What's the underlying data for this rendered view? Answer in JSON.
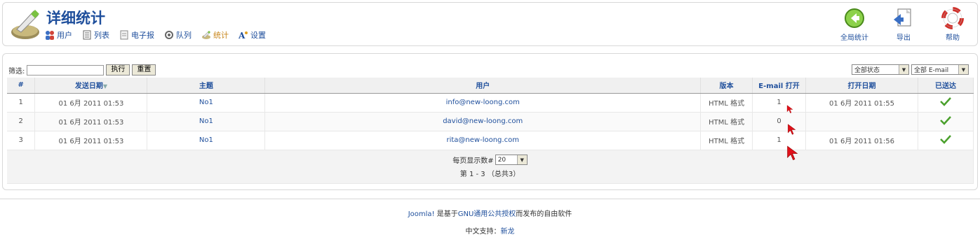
{
  "header": {
    "title": "详细统计",
    "menu": [
      {
        "label": "用户",
        "icon": "users-icon"
      },
      {
        "label": "列表",
        "icon": "list-icon"
      },
      {
        "label": "电子报",
        "icon": "newsletter-icon"
      },
      {
        "label": "队列",
        "icon": "queue-icon"
      },
      {
        "label": "统计",
        "icon": "stats-icon",
        "active": true
      },
      {
        "label": "设置",
        "icon": "settings-icon"
      }
    ],
    "toolbar": {
      "global_stats": "全局统计",
      "export": "导出",
      "help": "帮助"
    }
  },
  "filter": {
    "label": "筛选:",
    "value": "",
    "execute_label": "执行",
    "reset_label": "重置",
    "status_select": "全部状态",
    "email_select": "全部 E-mail"
  },
  "table": {
    "columns": [
      "#",
      "发送日期",
      "主题",
      "用户",
      "版本",
      "E-mail 打开",
      "打开日期",
      "已送达"
    ],
    "rows": [
      {
        "num": "1",
        "send_date": "01 6月 2011 01:53",
        "subject": "No1",
        "user": "info@new-loong.com",
        "version": "HTML 格式",
        "opened": "1",
        "open_date": "01 6月 2011 01:55"
      },
      {
        "num": "2",
        "send_date": "01 6月 2011 01:53",
        "subject": "No1",
        "user": "david@new-loong.com",
        "version": "HTML 格式",
        "opened": "0",
        "open_date": ""
      },
      {
        "num": "3",
        "send_date": "01 6月 2011 01:53",
        "subject": "No1",
        "user": "rita@new-loong.com",
        "version": "HTML 格式",
        "opened": "1",
        "open_date": "01 6月 2011 01:56"
      }
    ],
    "per_page_label": "每页显示数#",
    "per_page_value": "20",
    "pagination_text": "第 1 - 3 （总共3）"
  },
  "footer": {
    "joomla_link": "Joomla!",
    "text_mid": " 是基于",
    "gnu_link": "GNU通用公共授权",
    "text_end": "而发布的自由软件",
    "support_label": "中文支持：",
    "support_link": "新龙"
  },
  "colors": {
    "accent": "#1f4f9c",
    "active_menu": "#c8861a",
    "check": "#4aa02c",
    "cursor": "#e0101a"
  }
}
